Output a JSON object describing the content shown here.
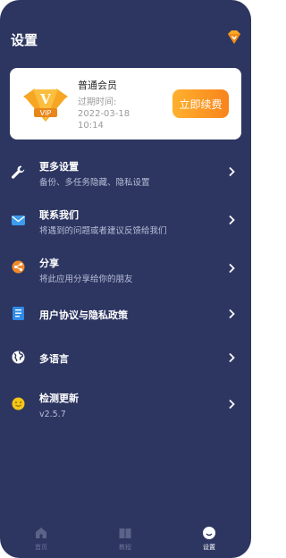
{
  "header": {
    "title": "设置",
    "icon": "diamond-icon"
  },
  "vip": {
    "title": "普通会员",
    "expiry_label": "过期时间:",
    "expiry_date": "2022-03-18",
    "expiry_time": "10:14",
    "badge": "vip-badge-icon",
    "renew_label": "立即续费"
  },
  "menu": [
    {
      "title": "更多设置",
      "subtitle": "备份、多任务隐藏、隐私设置",
      "icon": "wrench-icon"
    },
    {
      "title": "联系我们",
      "subtitle": "将遇到的问题或者建议反馈给我们",
      "icon": "mail-icon"
    },
    {
      "title": "分享",
      "subtitle": "将此应用分享给你的朋友",
      "icon": "share-icon"
    },
    {
      "title": "用户协议与隐私政策",
      "subtitle": "",
      "icon": "document-icon"
    },
    {
      "title": "多语言",
      "subtitle": "",
      "icon": "globe-icon"
    },
    {
      "title": "检测更新",
      "subtitle": "v2.5.7",
      "icon": "update-icon"
    }
  ],
  "tabs": [
    {
      "label": "首页",
      "icon": "home-icon",
      "active": false
    },
    {
      "label": "教程",
      "icon": "book-icon",
      "active": false
    },
    {
      "label": "设置",
      "icon": "smile-icon",
      "active": true
    }
  ],
  "colors": {
    "background": "#2d3661",
    "accent": "#f7941d",
    "card": "#ffffff"
  }
}
